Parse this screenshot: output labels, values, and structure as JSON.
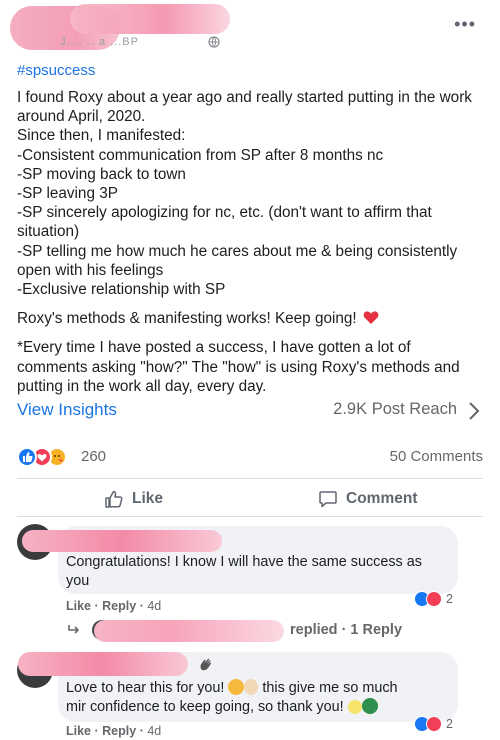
{
  "post": {
    "header_faint": "J.... .. a ...BP",
    "hashtag": "#spsuccess",
    "paragraph1_lines": [
      "I found Roxy about a year ago and really started putting in the work",
      "around April, 2020.",
      "Since then, I manifested:",
      "-Consistent communication from SP after 8 months nc",
      "-SP moving back to town",
      "-SP leaving 3P",
      "-SP sincerely apologizing for nc, etc. (don't want to affirm that",
      "situation)",
      "-SP telling me how much he cares about me & being consistently",
      "open with his feelings",
      "-Exclusive relationship with SP"
    ],
    "paragraph2": "Roxy's methods & manifesting works! Keep going!",
    "paragraph3_lines": [
      "*Every time I have posted a success, I have gotten a lot of",
      "comments asking \"how?\" The \"how\" is using Roxy's methods and",
      "putting in the work all day, every day."
    ]
  },
  "insights": {
    "view_label": "View Insights",
    "reach_label": "2.9K Post Reach"
  },
  "stats": {
    "reaction_count": "260",
    "comments_count": "50 Comments"
  },
  "actions": {
    "like_label": "Like",
    "comment_label": "Comment"
  },
  "comments": [
    {
      "text_lines": [
        "Congratulations! I know I will have the same success as",
        "you"
      ],
      "like_label": "Like",
      "reply_label": "Reply",
      "time": "4d",
      "reaction_count": "2"
    },
    {
      "text_line1_a": "Love to hear this for you!",
      "text_line1_b": "this give me so much",
      "text_line2": "mir confidence to keep going, so thank you!",
      "like_label": "Like",
      "reply_label": "Reply",
      "time": "4d",
      "reaction_count": "2"
    }
  ],
  "reply_summary": "replied · 1 Reply",
  "colors": {
    "link_blue": "#1b74e4",
    "like_blue": "#1877f2",
    "love_red": "#f33e58",
    "care_yellow": "#f7b125",
    "muted_text": "#65676b",
    "bubble_bg": "#f0f2f5",
    "redaction_pink": "#f48fab"
  }
}
